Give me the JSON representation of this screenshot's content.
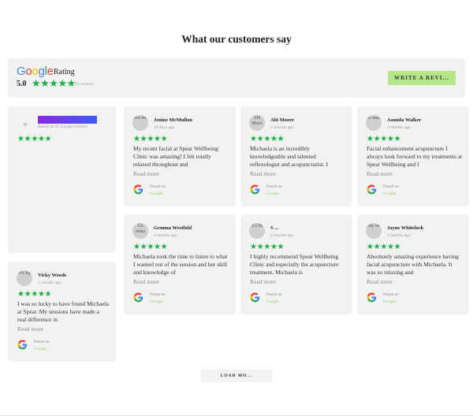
{
  "heading": "What our customers say",
  "summary": {
    "google_logo": [
      {
        "ch": "G",
        "color": "#4285F4"
      },
      {
        "ch": "o",
        "color": "#EA4335"
      },
      {
        "ch": "o",
        "color": "#FBBC05"
      },
      {
        "ch": "g",
        "color": "#4285F4"
      },
      {
        "ch": "l",
        "color": "#34A853"
      },
      {
        "ch": "e",
        "color": "#EA4335"
      }
    ],
    "rating_label": "Rating",
    "score": "5.0",
    "stars": "★★★★★",
    "count": "22 reviews",
    "write_button": "WRITE A REVI..."
  },
  "featured": {
    "based_on": "Based on 22 Google reviews",
    "stars": "★★★★★"
  },
  "colors": {
    "star": "#17b33f",
    "card_bg": "#f2f2f2",
    "write_button": "#b5e78a",
    "posted_source": "#9ccf6b"
  },
  "reviews": [
    {
      "name": "Jenine McMullon",
      "avatar": "Jen ine",
      "time": "24 days ago",
      "stars": "★★★★★",
      "text": "My recent facial at Spear Wellbeing Clinic was amazing! I felt totally relaxed throughout and",
      "read_more": "Read more",
      "posted": "Posted on",
      "source": "Google"
    },
    {
      "name": "Abi Moore",
      "avatar": "Abi Moor",
      "time": "2 months ago",
      "stars": "★★★★★",
      "text": "Michaela is an incredibly knowledgeable and talented reflexologist and acupuncturist. I",
      "read_more": "Read more",
      "posted": "Posted on",
      "source": "Google"
    },
    {
      "name": "Asunda Walker",
      "avatar": "As unda",
      "time": "2 months ago",
      "stars": "★★★★★",
      "text": "Facial enhancement acupuncture I always look forward to my treatments at Spear Wellbeing and I",
      "read_more": "Read more",
      "posted": "Posted on",
      "source": "Google"
    },
    {
      "name": "Gemma Westfold",
      "avatar": "Ge mma",
      "time": "3 months ago",
      "stars": "★★★★★",
      "text": "Michaela took the time to listen to what I wanted out of the session and her skill and knowledge of",
      "read_more": "Read more",
      "posted": "Posted on",
      "source": "Google"
    },
    {
      "name": "S ...",
      "avatar": "S LM",
      "time": "4 months ago",
      "stars": "★★★★★",
      "text": "I highly recommend Spear Wellbeing Clinic and especially the acupuncture treatment. Michaela is",
      "read_more": "Read more",
      "posted": "Posted on",
      "source": "Google"
    },
    {
      "name": "Jayne Whitelock",
      "avatar": "Jay ne",
      "time": "5 months ago",
      "stars": "★★★★★",
      "text": "Absolutely amazing experience having facial acupuncture with Michaela. It was so relaxing and",
      "read_more": "Read more",
      "posted": "Posted on",
      "source": "Google"
    },
    {
      "name": "Vicky Woods",
      "avatar": "Vic ky",
      "time": "5 months ago",
      "stars": "★★★★★",
      "text": "I was so lucky to have found Michaela at Spear. My sessions have made a real difference in",
      "read_more": "Read more",
      "posted": "Posted on",
      "source": "Google"
    }
  ],
  "load_more": "LOAD MO..."
}
